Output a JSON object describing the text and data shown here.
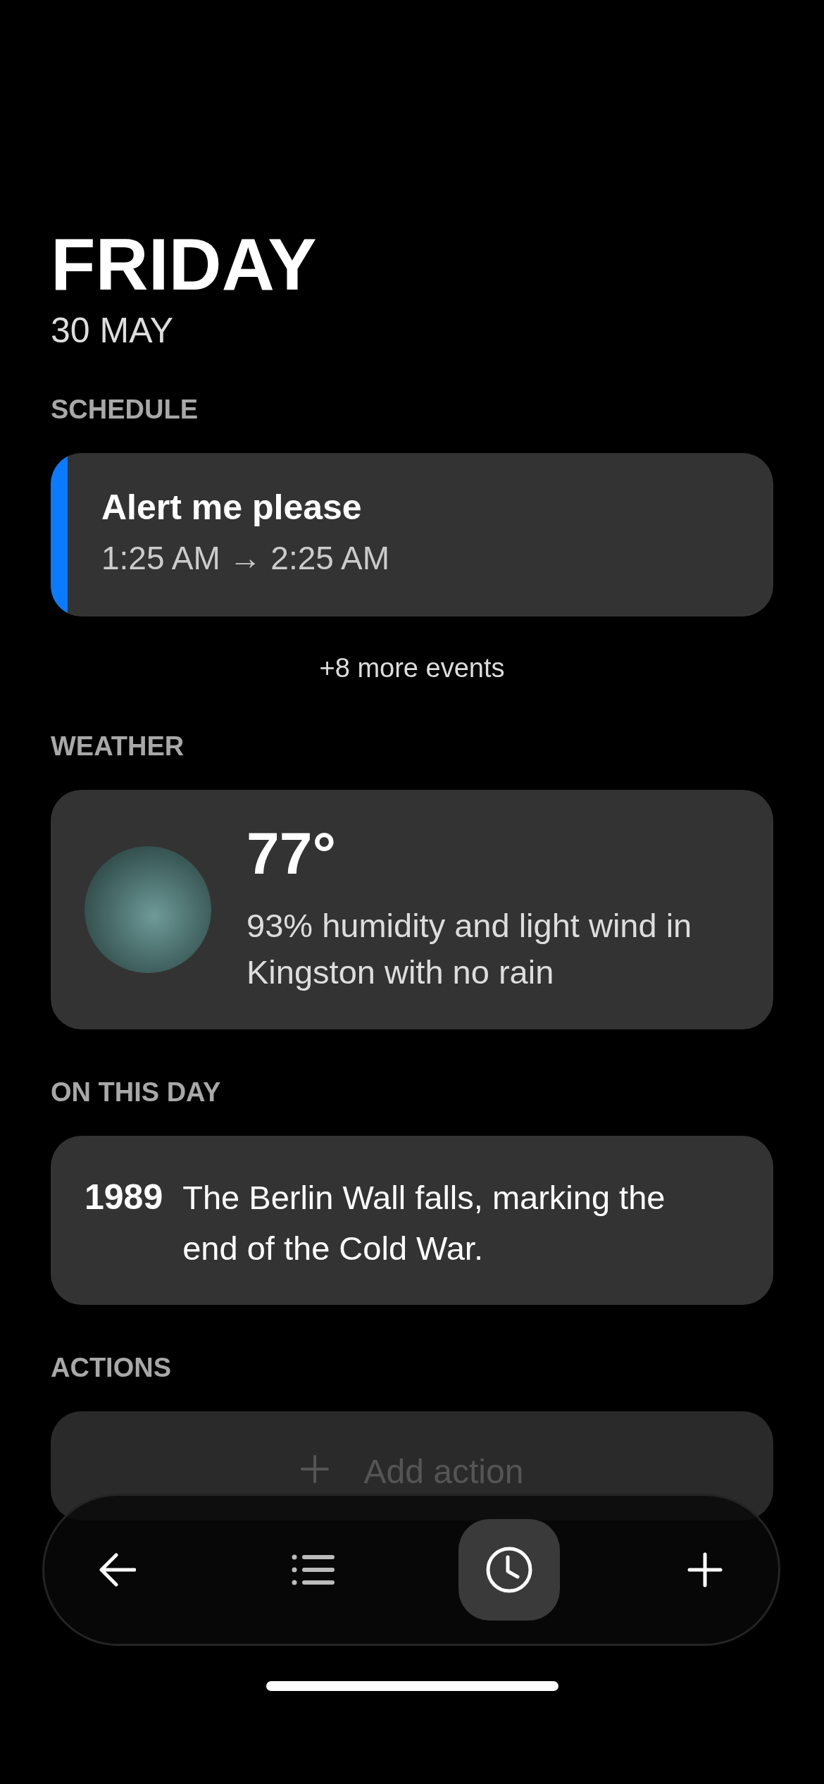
{
  "header": {
    "day": "FRIDAY",
    "date": "30 MAY"
  },
  "schedule": {
    "heading": "SCHEDULE",
    "events": [
      {
        "title": "Alert me please",
        "time": "1:25 AM → 2:25 AM",
        "color": "#0a7aff"
      }
    ],
    "more": "+8 more events"
  },
  "weather": {
    "heading": "WEATHER",
    "temperature": "77°",
    "summary": "93% humidity and light wind in Kingston with no rain"
  },
  "on_this_day": {
    "heading": "ON THIS DAY",
    "year": "1989",
    "text": "The Berlin Wall falls, marking the end of the Cold War."
  },
  "actions": {
    "heading": "ACTIONS",
    "add_label": "Add action"
  },
  "nav": [
    {
      "kind": "back",
      "selected": false
    },
    {
      "kind": "list",
      "selected": false
    },
    {
      "kind": "clock",
      "selected": true
    },
    {
      "kind": "add",
      "selected": false
    }
  ]
}
